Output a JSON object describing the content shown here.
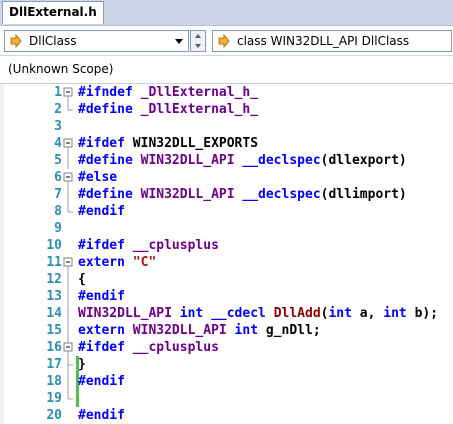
{
  "tab": {
    "title": "DllExternal.h"
  },
  "toolbar": {
    "class_combo": {
      "value": "DllClass",
      "icon": "class-arrow-icon"
    },
    "member_combo": {
      "value": "class WIN32DLL_API DllClass",
      "icon": "class-arrow-icon"
    }
  },
  "scope": {
    "label": "(Unknown Scope)"
  },
  "colors": {
    "line_number": "#2b91af",
    "keyword": "#0000ff",
    "macro": "#6f008a",
    "string": "#a31515",
    "function": "#880000",
    "changed_bar": "#4fbf4f",
    "saved_bar": "#f5e342"
  },
  "lines": [
    {
      "n": "1",
      "outline": "box-minus",
      "segs": [
        {
          "t": "#ifndef ",
          "c": "kw"
        },
        {
          "t": "_DllExternal_h_",
          "c": "mac"
        }
      ]
    },
    {
      "n": "2",
      "outline": "end",
      "segs": [
        {
          "t": "#define ",
          "c": "kw"
        },
        {
          "t": "_DllExternal_h_",
          "c": "mac"
        }
      ]
    },
    {
      "n": "3",
      "outline": "none",
      "segs": []
    },
    {
      "n": "4",
      "outline": "box-minus",
      "segs": [
        {
          "t": "#ifdef ",
          "c": "kw"
        },
        {
          "t": "WIN32DLL_EXPORTS",
          "c": ""
        }
      ]
    },
    {
      "n": "5",
      "outline": "mid",
      "segs": [
        {
          "t": "#define ",
          "c": "kw"
        },
        {
          "t": "WIN32DLL_API",
          "c": "mac"
        },
        {
          "t": " ",
          "c": ""
        },
        {
          "t": "__declspec",
          "c": "kw"
        },
        {
          "t": "(dllexport)",
          "c": ""
        }
      ]
    },
    {
      "n": "6",
      "outline": "box-minus",
      "segs": [
        {
          "t": "#else",
          "c": "kw"
        }
      ]
    },
    {
      "n": "7",
      "outline": "mid",
      "segs": [
        {
          "t": "#define ",
          "c": "kw"
        },
        {
          "t": "WIN32DLL_API",
          "c": "mac"
        },
        {
          "t": " ",
          "c": ""
        },
        {
          "t": "__declspec",
          "c": "kw"
        },
        {
          "t": "(dllimport)",
          "c": ""
        }
      ]
    },
    {
      "n": "8",
      "outline": "end",
      "segs": [
        {
          "t": "#endif",
          "c": "kw"
        }
      ]
    },
    {
      "n": "9",
      "outline": "none",
      "segs": []
    },
    {
      "n": "10",
      "outline": "none",
      "segs": [
        {
          "t": "#ifdef ",
          "c": "kw"
        },
        {
          "t": "__cplusplus",
          "c": "mac"
        }
      ]
    },
    {
      "n": "11",
      "outline": "box-minus",
      "segs": [
        {
          "t": "extern ",
          "c": "kw"
        },
        {
          "t": "\"C\"",
          "c": "str"
        }
      ]
    },
    {
      "n": "12",
      "outline": "mid",
      "segs": [
        {
          "t": "{",
          "c": ""
        }
      ]
    },
    {
      "n": "13",
      "outline": "mid",
      "segs": [
        {
          "t": "#endif",
          "c": "kw"
        }
      ]
    },
    {
      "n": "14",
      "outline": "mid",
      "segs": [
        {
          "t": "WIN32DLL_API",
          "c": "mac"
        },
        {
          "t": " ",
          "c": ""
        },
        {
          "t": "int",
          "c": "kw"
        },
        {
          "t": " ",
          "c": ""
        },
        {
          "t": "__cdecl",
          "c": "kw"
        },
        {
          "t": " ",
          "c": ""
        },
        {
          "t": "DllAdd",
          "c": "fn"
        },
        {
          "t": "(",
          "c": ""
        },
        {
          "t": "int",
          "c": "kw"
        },
        {
          "t": " a, ",
          "c": ""
        },
        {
          "t": "int",
          "c": "kw"
        },
        {
          "t": " b);",
          "c": ""
        }
      ]
    },
    {
      "n": "15",
      "outline": "mid",
      "segs": [
        {
          "t": "extern ",
          "c": "kw"
        },
        {
          "t": "WIN32DLL_API",
          "c": "mac"
        },
        {
          "t": " ",
          "c": ""
        },
        {
          "t": "int",
          "c": "kw"
        },
        {
          "t": " g_nDll;",
          "c": ""
        }
      ]
    },
    {
      "n": "16",
      "outline": "box-minus-inner",
      "segs": [
        {
          "t": "#ifdef ",
          "c": "kw"
        },
        {
          "t": "__cplusplus",
          "c": "mac"
        }
      ]
    },
    {
      "n": "17",
      "outline": "end-inner",
      "segs": [
        {
          "t": "}",
          "c": ""
        }
      ]
    },
    {
      "n": "18",
      "outline": "mid",
      "segs": [
        {
          "t": "#endif",
          "c": "kw"
        }
      ]
    },
    {
      "n": "19",
      "outline": "end",
      "segs": []
    },
    {
      "n": "20",
      "outline": "none",
      "segs": [
        {
          "t": "#endif",
          "c": "kw"
        }
      ]
    }
  ]
}
